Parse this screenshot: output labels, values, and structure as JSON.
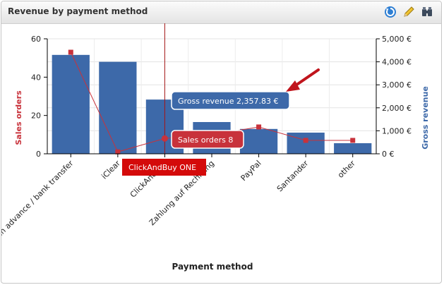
{
  "panel": {
    "title": "Revenue by payment method"
  },
  "toolbar": {
    "refresh_icon": "refresh-icon",
    "edit_icon": "pencil-icon",
    "settings_icon": "binoculars-icon"
  },
  "chart_data": {
    "type": "bar",
    "xlabel": "Payment method",
    "ylabel_left": "Sales orders",
    "ylabel_right": "Gross revenue",
    "ylim_left": [
      0,
      60
    ],
    "ylim_right": [
      0,
      5000
    ],
    "left_ticks": [
      "0",
      "20",
      "40",
      "60"
    ],
    "right_ticks": [
      "0 €",
      "1,000 €",
      "2,000 €",
      "3,000 €",
      "4,000 €",
      "5,000 €"
    ],
    "categories": [
      "Cash in advance / bank transfer",
      "iClear",
      "ClickAndBuy",
      "Zahlung auf Rechnung",
      "PayPal",
      "Santander",
      "other"
    ],
    "category_labels": [
      "Cash in advance / bank transfer",
      "iClear",
      "ClickAndBuy",
      "Zahlung auf Rechnung",
      "PayPal",
      "Santander",
      "other"
    ],
    "series": [
      {
        "name": "Gross revenue",
        "type": "bar",
        "axis": "right",
        "color": "#3d69a9",
        "values": [
          4300,
          4000,
          2357.83,
          1380,
          1080,
          920,
          460
        ]
      },
      {
        "name": "Sales orders",
        "type": "line",
        "axis": "left",
        "color": "#c8323b",
        "values": [
          53,
          1,
          8,
          10,
          14,
          7,
          7
        ]
      }
    ],
    "crosshair_category": "ClickAndBuy",
    "tooltips": {
      "revenue": "Gross revenue 2,357.83 €",
      "orders": "Sales orders 8",
      "category": "ClickAndBuy ONE"
    },
    "grid": true
  }
}
